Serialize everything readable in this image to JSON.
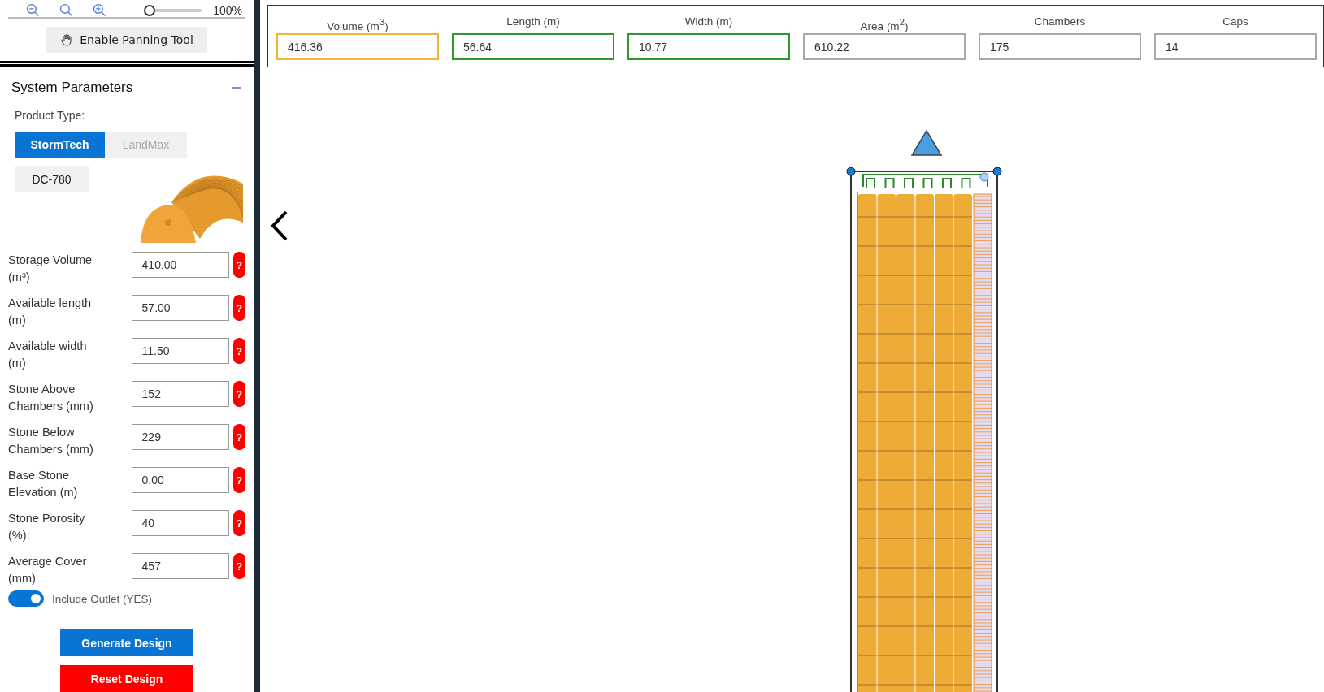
{
  "toolbar": {
    "zoom_slider": {
      "level": 0.15
    },
    "zoom_percent": "100%",
    "panning_button": "Enable Panning Tool"
  },
  "system_parameters": {
    "title": "System Parameters",
    "expanded": true,
    "product_type_label": "Product Type:",
    "product_tabs": [
      {
        "label": "StormTech",
        "selected": true
      },
      {
        "label": "LandMax",
        "selected": false
      }
    ],
    "model_button": "DC-780",
    "parameters": [
      {
        "label": "Storage Volume (m³)",
        "value": "410.00",
        "help": "?"
      },
      {
        "label": "Available length (m)",
        "value": "57.00",
        "help": "?"
      },
      {
        "label": "Available width (m)",
        "value": "11.50",
        "help": "?"
      },
      {
        "label": "Stone Above Chambers (mm)",
        "value": "152",
        "help": "?"
      },
      {
        "label": "Stone Below Chambers (mm)",
        "value": "229",
        "help": "?"
      },
      {
        "label": "Base Stone Elevation (m)",
        "value": "0.00",
        "help": "?"
      },
      {
        "label": "Stone Porosity (%):",
        "value": "40",
        "help": "?"
      },
      {
        "label": "Average Cover (mm)",
        "value": "457",
        "help": "?"
      }
    ],
    "include_outlet": {
      "label": "Include Outlet (YES)",
      "on": true
    },
    "buttons": [
      {
        "label": "Generate Design",
        "kind": "primary"
      },
      {
        "label": "Reset Design",
        "kind": "danger"
      }
    ]
  },
  "summary": [
    {
      "label": "Volume (m$^{3}$)",
      "value": "416.36",
      "color": "#f5b335"
    },
    {
      "label": "Length (m)",
      "value": "56.64",
      "color": "#2e9a2e"
    },
    {
      "label": "Width (m)",
      "value": "10.77",
      "color": "#2e9a2e"
    },
    {
      "label": "Area (m$^{2}$)",
      "value": "610.22",
      "color": "#a8a8a8"
    },
    {
      "label": "Chambers",
      "value": "175",
      "color": "#a8a8a8"
    },
    {
      "label": "Caps",
      "value": "14",
      "color": "#a8a8a8"
    }
  ]
}
